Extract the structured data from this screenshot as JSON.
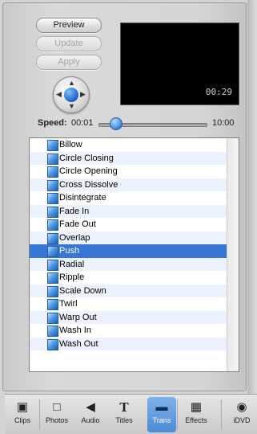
{
  "controls": {
    "preview_label": "Preview",
    "update_label": "Update",
    "apply_label": "Apply"
  },
  "preview": {
    "timecode": "00:29"
  },
  "speed": {
    "label": "Speed:",
    "min": "00:01",
    "max": "10:00",
    "level_fraction": 0.12
  },
  "transitions": [
    "Billow",
    "Circle Closing",
    "Circle Opening",
    "Cross Dissolve",
    "Disintegrate",
    "Fade In",
    "Fade Out",
    "Overlap",
    "Push",
    "Radial",
    "Ripple",
    "Scale Down",
    "Twirl",
    "Warp Out",
    "Wash In",
    "Wash Out"
  ],
  "selected_transition": "Push",
  "toolbar": {
    "items": [
      {
        "label": "Clips",
        "icon": "clips-icon"
      },
      {
        "label": "Photos",
        "icon": "photos-icon"
      },
      {
        "label": "Audio",
        "icon": "audio-icon"
      },
      {
        "label": "Titles",
        "icon": "titles-icon"
      },
      {
        "label": "Trans",
        "icon": "transitions-icon"
      },
      {
        "label": "Effects",
        "icon": "effects-icon"
      },
      {
        "label": "iDVD",
        "icon": "idvd-icon"
      }
    ],
    "active": "Trans"
  },
  "colors": {
    "selection": "#3876d6",
    "alt_row": "#edf3fe",
    "active_tab": "#4d8bd8"
  }
}
